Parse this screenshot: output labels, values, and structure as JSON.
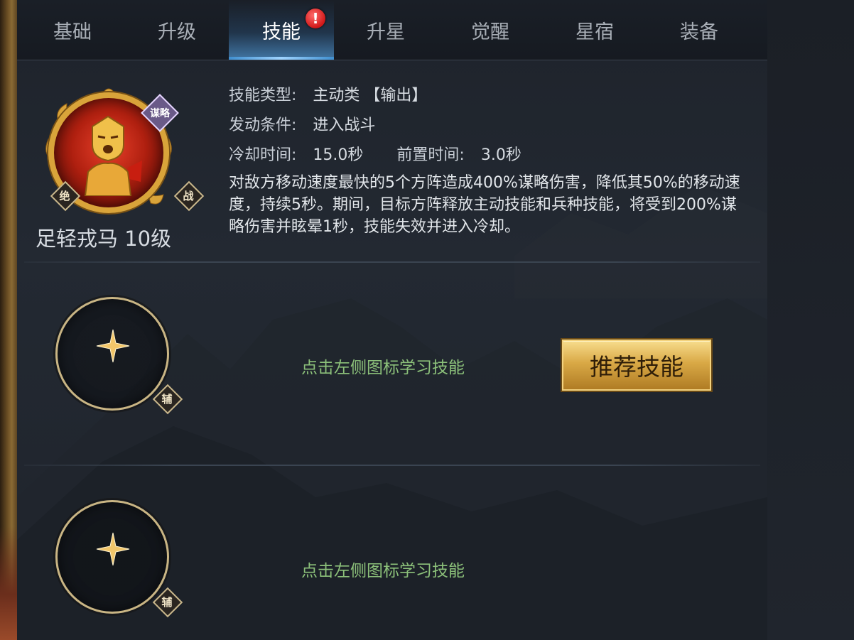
{
  "tabs": [
    {
      "label": "基础",
      "active": false
    },
    {
      "label": "升级",
      "active": false
    },
    {
      "label": "技能",
      "active": true,
      "alert": "!"
    },
    {
      "label": "升星",
      "active": false
    },
    {
      "label": "觉醒",
      "active": false
    },
    {
      "label": "星宿",
      "active": false
    },
    {
      "label": "装备",
      "active": false
    }
  ],
  "skill": {
    "name": "足轻戎马 10级",
    "tag_type": "谋略",
    "tag_left": "绝",
    "tag_right": "战",
    "type_label": "技能类型:",
    "type_value": "主动类 【输出】",
    "trigger_label": "发动条件:",
    "trigger_value": "进入战斗",
    "cooldown_label": "冷却时间:",
    "cooldown_value": "15.0秒",
    "pre_label": "前置时间:",
    "pre_value": "3.0秒",
    "description": "对敌方移动速度最快的5个方阵造成400%谋略伤害，降低其50%的移动速度，持续5秒。期间，目标方阵释放主动技能和兵种技能，将受到200%谋略伤害并眩晕1秒，技能失效并进入冷却。"
  },
  "slots": [
    {
      "tag": "辅",
      "hint": "点击左侧图标学习技能",
      "button": "推荐技能"
    },
    {
      "tag": "辅",
      "hint": "点击左侧图标学习技能"
    }
  ],
  "colors": {
    "hint_green": "#8cc17a",
    "gold": "#d9a946",
    "tab_active": "#ffffff"
  }
}
